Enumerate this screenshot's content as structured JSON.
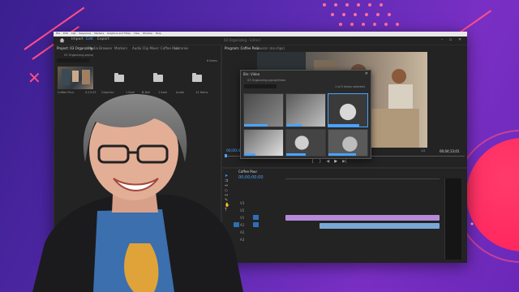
{
  "menu": {
    "items": [
      "File",
      "Edit",
      "Clip",
      "Sequence",
      "Markers",
      "Graphics and Titles",
      "View",
      "Window",
      "Help"
    ]
  },
  "workspace": {
    "import": "Import",
    "edit": "Edit",
    "export": "Export"
  },
  "project": {
    "title": "03 Organizing",
    "modified": "- Edited"
  },
  "project_panel": {
    "tabs": [
      "Project: 03 Organizing",
      "Media Browser",
      "Markers",
      "Audio Clip Mixer: Coffee Pour",
      "Libraries"
    ],
    "path": "03 Organizing.prproj",
    "count": "6 Items",
    "items": [
      {
        "label": "Coffee Pour",
        "meta": "4:13:23"
      },
      {
        "label": "Graphics",
        "meta": "1 Item"
      },
      {
        "label": "B-Roll",
        "meta": "1 Item"
      },
      {
        "label": "Audio",
        "meta": "12 Items"
      },
      {
        "label": "Video",
        "meta": "5 Items"
      }
    ]
  },
  "program": {
    "tabs": [
      "Program: Coffee Pour",
      "Source: (no clips)"
    ],
    "timecode": "00;00;00;00",
    "duration": "00;04;13;01",
    "fit": "Fit",
    "zoom": "1/2"
  },
  "bin": {
    "title": "Bin: Video",
    "path": "03 Organizing.prproj\\Video",
    "count": "1 of 5 items selected"
  },
  "timeline": {
    "tab": "Coffee Pour",
    "timecode": "00;00;00;00",
    "tracks": [
      "V3",
      "V2",
      "V1",
      "A1",
      "A2",
      "A3"
    ]
  },
  "colors": {
    "accent": "#4aa3ff",
    "video_clip": "#b58ad8",
    "audio_clip": "#7aa8d6",
    "bg": "#5a2bb0",
    "pink": "#ff4f8a"
  }
}
